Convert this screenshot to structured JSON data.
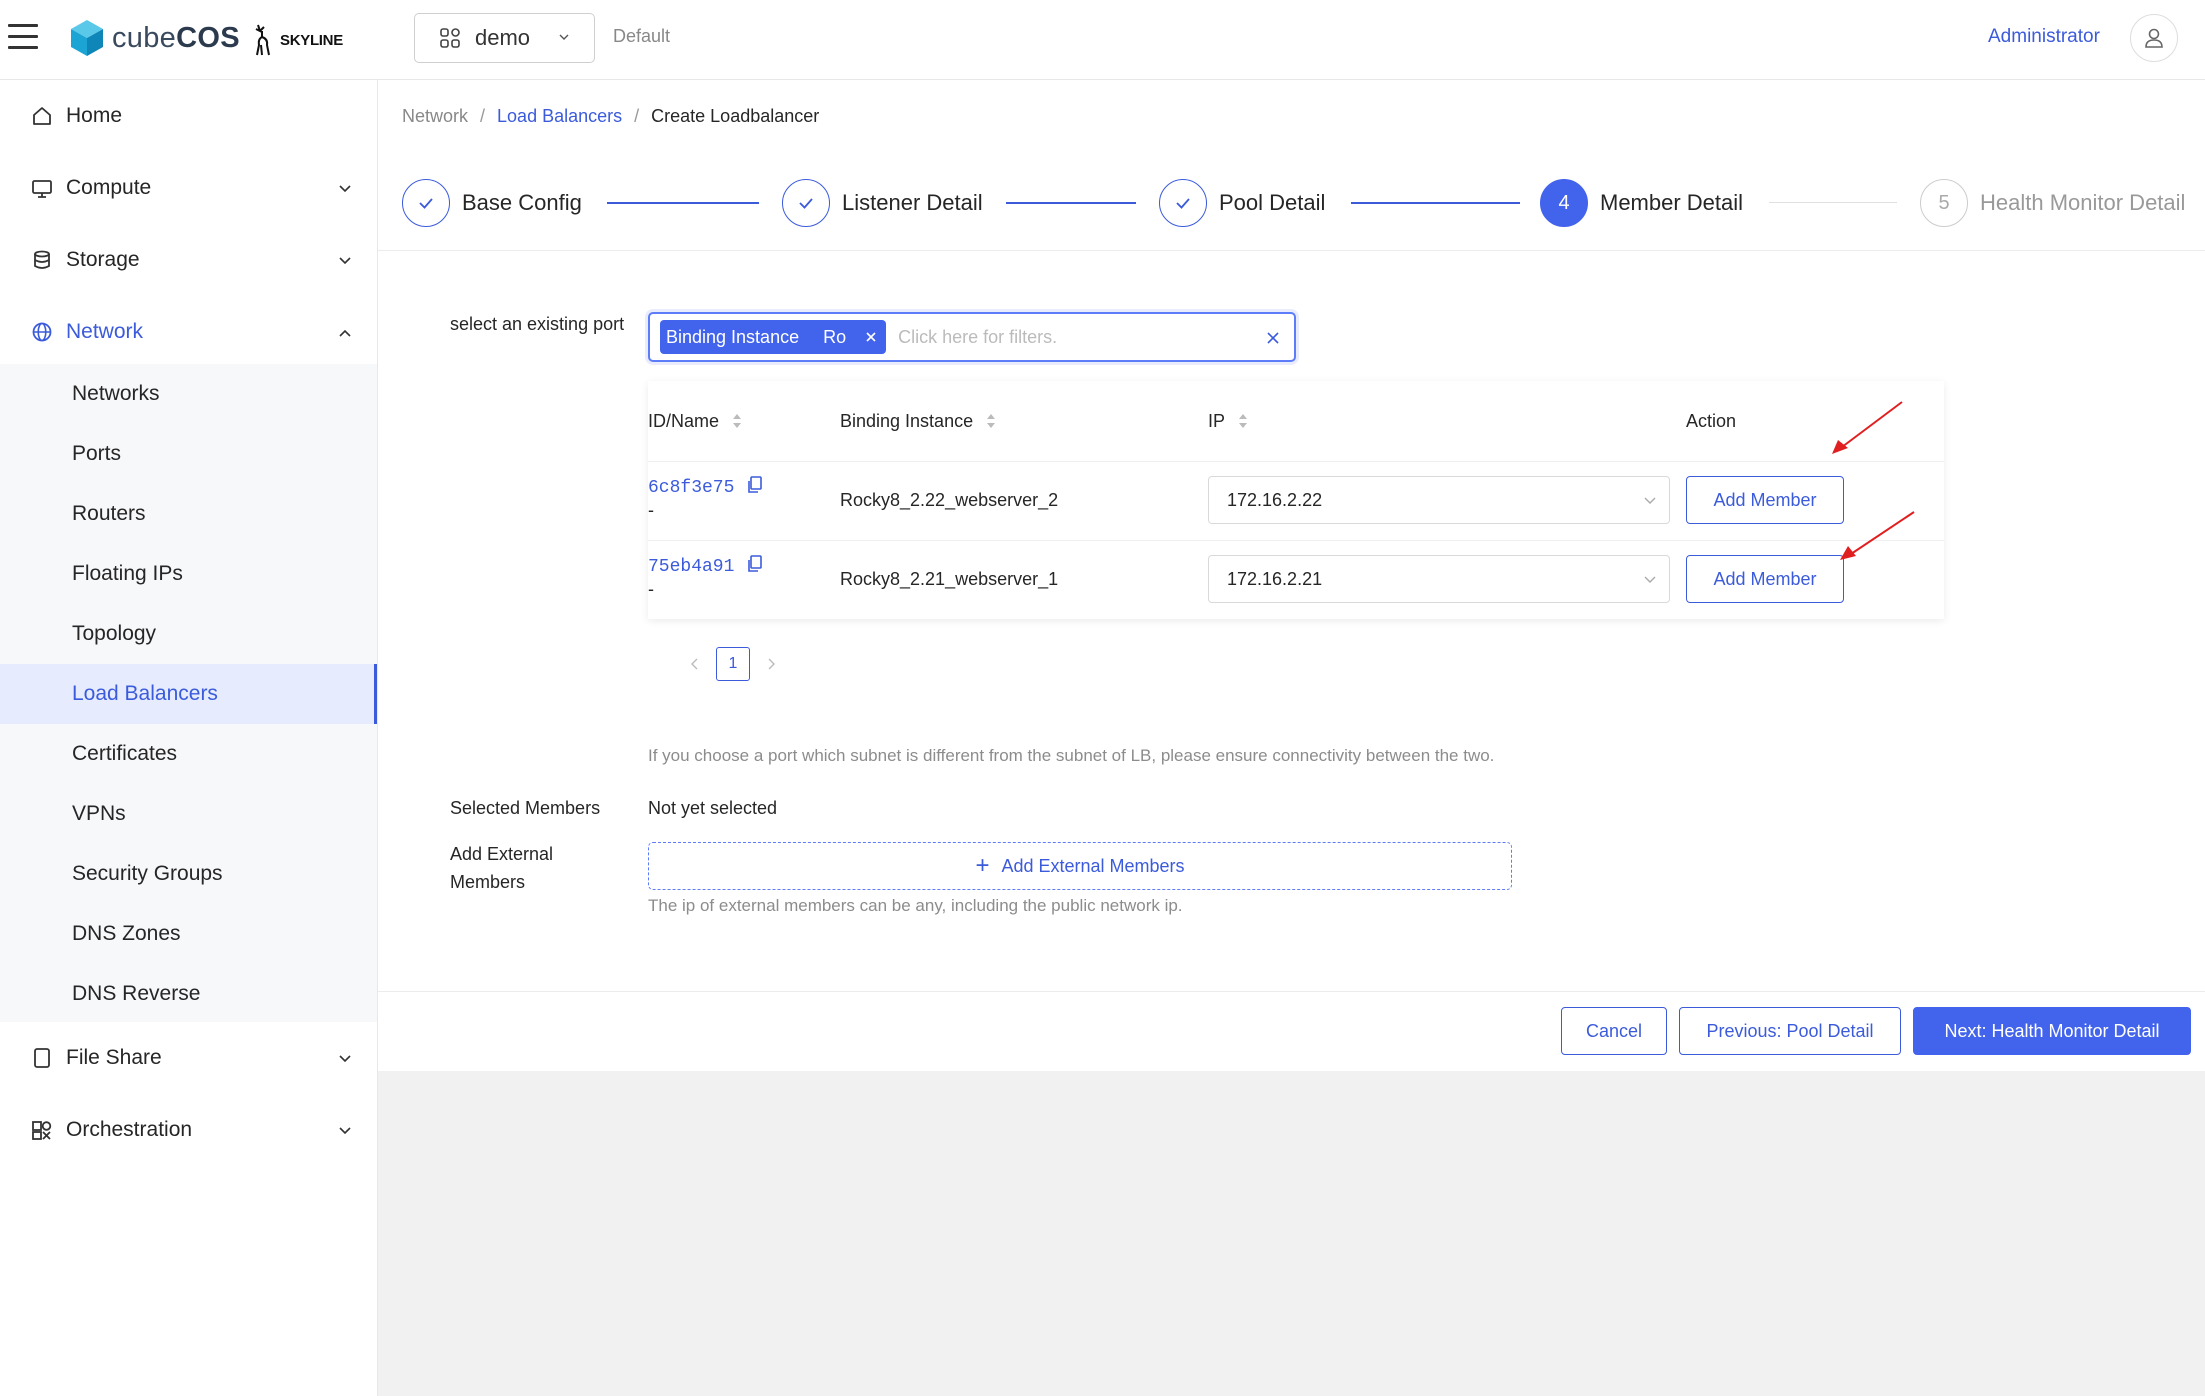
{
  "header": {
    "brand": "cube",
    "brand_bold": "COS",
    "partner": "SKYLINE",
    "project": "demo",
    "domain": "Default",
    "user": "Administrator"
  },
  "sidebar": {
    "items": [
      {
        "label": "Home",
        "icon": "home-icon"
      },
      {
        "label": "Compute",
        "icon": "monitor-icon"
      },
      {
        "label": "Storage",
        "icon": "database-icon"
      },
      {
        "label": "Network",
        "icon": "globe-icon"
      },
      {
        "label": "File Share",
        "icon": "file-icon"
      },
      {
        "label": "Orchestration",
        "icon": "orchestration-icon"
      }
    ],
    "network_sub": [
      "Networks",
      "Ports",
      "Routers",
      "Floating IPs",
      "Topology",
      "Load Balancers",
      "Certificates",
      "VPNs",
      "Security Groups",
      "DNS Zones",
      "DNS Reverse"
    ],
    "active_sub": "Load Balancers"
  },
  "breadcrumb": {
    "root": "Network",
    "parent": "Load Balancers",
    "current": "Create Loadbalancer",
    "sep": "/"
  },
  "steps": [
    {
      "label": "Base Config",
      "state": "done"
    },
    {
      "label": "Listener Detail",
      "state": "done"
    },
    {
      "label": "Pool Detail",
      "state": "done"
    },
    {
      "label": "Member Detail",
      "state": "current",
      "number": "4"
    },
    {
      "label": "Health Monitor Detail",
      "state": "pending",
      "number": "5"
    }
  ],
  "form": {
    "port_label": "select an existing port",
    "filter": {
      "tag_key": "Binding Instance",
      "tag_value": "Ro",
      "placeholder": "Click here for filters."
    },
    "table": {
      "columns": [
        "ID/Name",
        "Binding Instance",
        "IP",
        "Action"
      ],
      "rows": [
        {
          "id": "6c8f3e75",
          "name": "-",
          "instance": "Rocky8_2.22_webserver_2",
          "ip": "172.16.2.22",
          "action": "Add Member"
        },
        {
          "id": "75eb4a91",
          "name": "-",
          "instance": "Rocky8_2.21_webserver_1",
          "ip": "172.16.2.21",
          "action": "Add Member"
        }
      ]
    },
    "page": "1",
    "subnet_hint": "If you choose a port which subnet is different from the subnet of LB, please ensure connectivity between the two.",
    "selected_label": "Selected Members",
    "selected_value": "Not yet selected",
    "external_label": "Add External Members",
    "external_button": "Add External Members",
    "external_hint": "The ip of external members can be any, including the public network ip."
  },
  "footer": {
    "cancel": "Cancel",
    "previous": "Previous: Pool Detail",
    "next": "Next: Health Monitor Detail"
  },
  "colors": {
    "primary": "#4263eb",
    "link": "#3b5bdb",
    "annotation_arrow": "#e02020"
  }
}
